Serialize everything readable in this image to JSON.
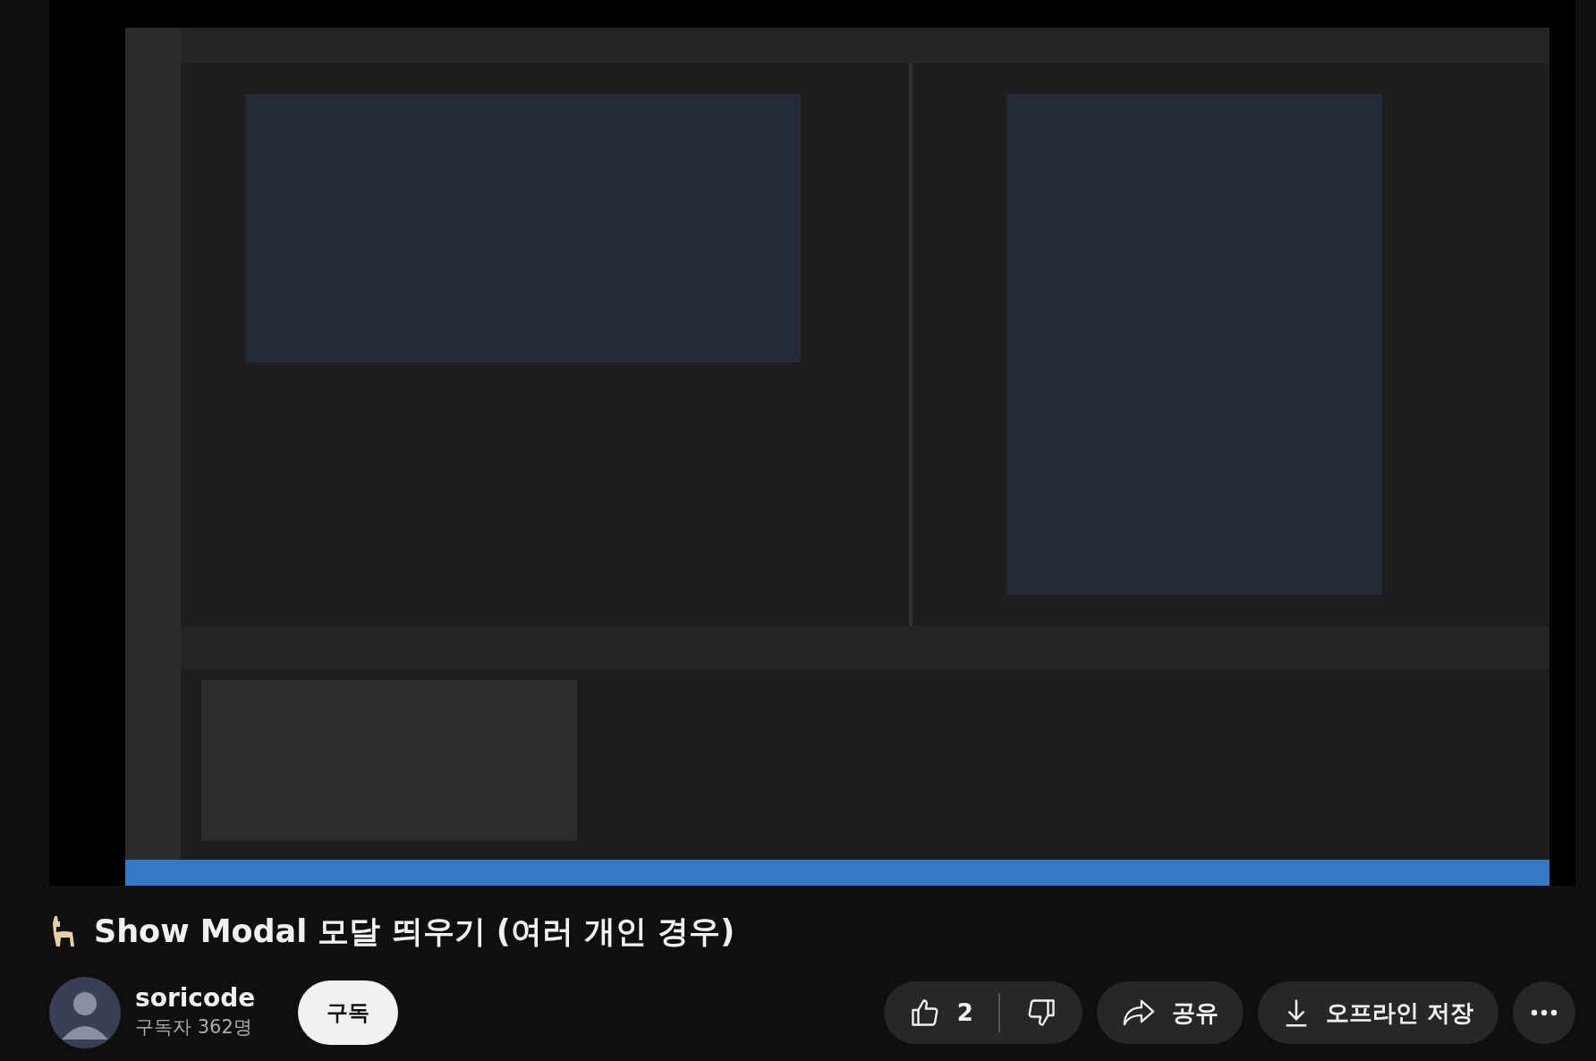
{
  "title": "Show Modal 모달 띄우기 (여러 개인 경우)",
  "channel": {
    "name": "soricode",
    "subscribers": "구독자 362명"
  },
  "subscribe_button": "구독",
  "actions": {
    "like_count": "2",
    "share": "공유",
    "download": "오프라인 저장"
  }
}
